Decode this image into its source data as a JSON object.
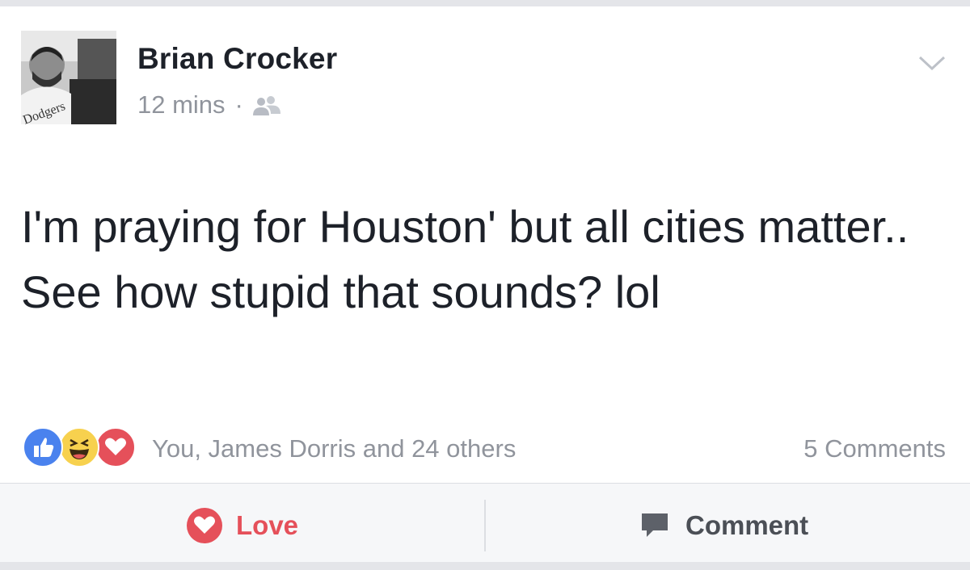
{
  "post": {
    "author": "Brian Crocker",
    "timestamp": "12 mins",
    "separator": "·",
    "audience_icon": "friends-icon",
    "text": "I'm praying for Houston' but all cities matter.. See how stupid that sounds? lol"
  },
  "reactions": {
    "types": [
      "like-reaction-icon",
      "haha-reaction-icon",
      "love-reaction-icon"
    ],
    "summary": "You, James Dorris and 24 others",
    "comments_count": "5 Comments"
  },
  "actions": {
    "love_label": "Love",
    "comment_label": "Comment"
  },
  "colors": {
    "love": "#e5505a",
    "like": "#4a82ee",
    "haha": "#f7d14e",
    "muted_text": "#90949c",
    "main_text": "#1d2129"
  }
}
